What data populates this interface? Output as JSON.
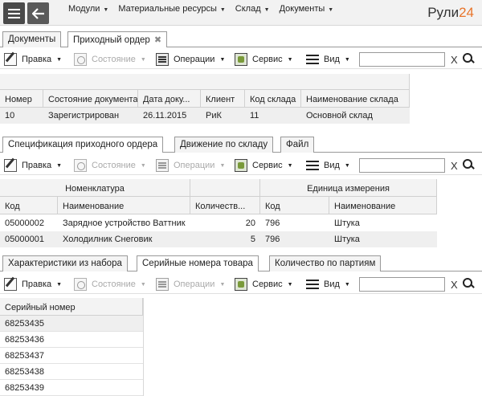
{
  "topbar": {
    "menu": [
      {
        "label": "Модули"
      },
      {
        "label": "Материальные ресурсы"
      },
      {
        "label": "Склад"
      },
      {
        "label": "Документы"
      }
    ],
    "logo": {
      "part1": "Рули",
      "part2": "24"
    }
  },
  "doc_tabs": [
    {
      "label": "Документы",
      "active": false
    },
    {
      "label": "Приходный ордер",
      "active": true,
      "close": "✖"
    }
  ],
  "toolbar": {
    "edit": "Правка",
    "state": "Состояние",
    "ops": "Операции",
    "service": "Сервис",
    "view": "Вид",
    "search_value": "",
    "clear": "X"
  },
  "header_grid": {
    "columns": [
      "Номер",
      "Состояние документа",
      "Дата доку...",
      "Клиент",
      "Код склада",
      "Наименование склада"
    ],
    "row": [
      "10",
      "Зарегистрирован",
      "26.11.2015",
      "РиК",
      "11",
      "Основной склад"
    ]
  },
  "spec_tabs": [
    {
      "label": "Спецификация приходного ордера",
      "active": true
    },
    {
      "label": "Движение по складу",
      "active": false
    },
    {
      "label": "Файл",
      "active": false
    }
  ],
  "spec_grid": {
    "group_nom": "Номенклатура",
    "group_unit": "Единица измерения",
    "columns": [
      "Код",
      "Наименование",
      "Количеств...",
      "Код",
      "Наименование"
    ],
    "rows": [
      [
        "05000002",
        "Зарядное устройство Ваттник",
        "20",
        "796",
        "Штука"
      ],
      [
        "05000001",
        "Холодилник Снеговик",
        "5",
        "796",
        "Штука"
      ]
    ]
  },
  "detail_tabs": [
    {
      "label": "Характеристики из набора",
      "active": false
    },
    {
      "label": "Серийные номера товара",
      "active": true
    },
    {
      "label": "Количество по партиям",
      "active": false
    }
  ],
  "serial_grid": {
    "header": "Серийный номер",
    "rows": [
      "68253435",
      "68253436",
      "68253437",
      "68253438",
      "68253439"
    ]
  },
  "colors": {
    "accent": "#e8742a",
    "dark_button": "#4a4a4a"
  }
}
